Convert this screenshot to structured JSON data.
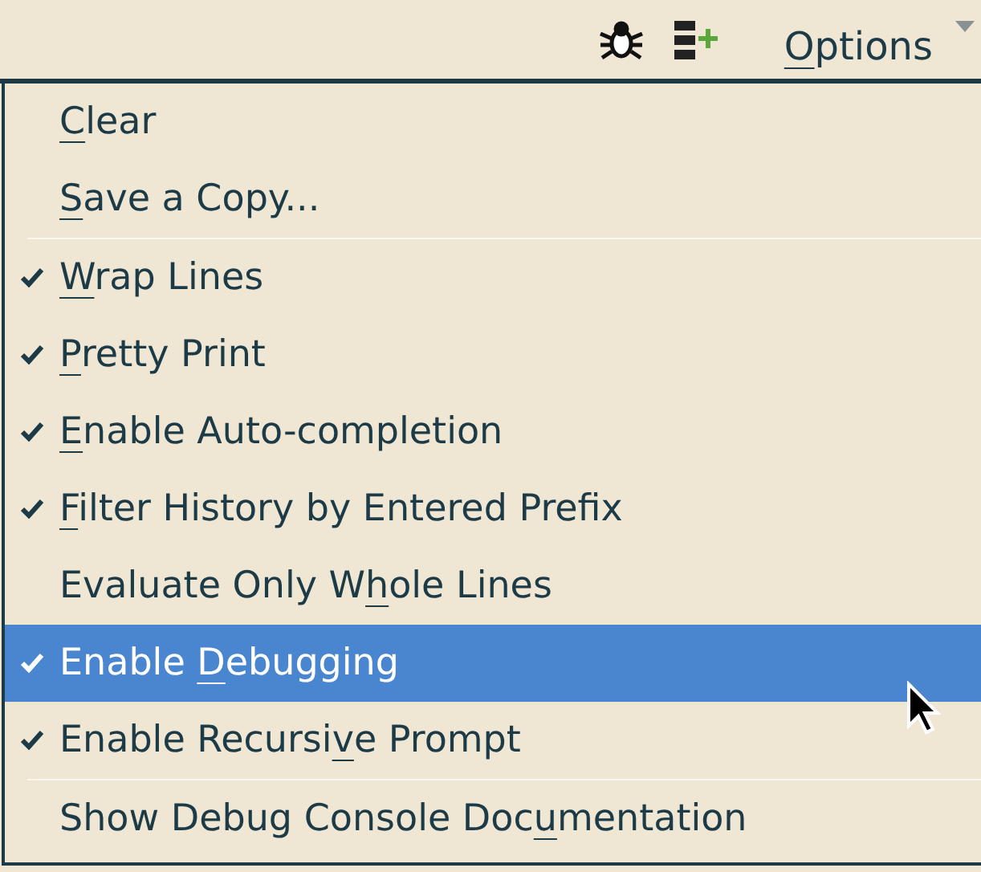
{
  "toolbar": {
    "options_menu": {
      "key": "O",
      "after": "ptions"
    }
  },
  "menu": {
    "items": [
      {
        "kind": "item",
        "checked": false,
        "selected": false,
        "key": "C",
        "after": "lear"
      },
      {
        "kind": "item",
        "checked": false,
        "selected": false,
        "key": "S",
        "after": "ave a Copy..."
      },
      {
        "kind": "separator"
      },
      {
        "kind": "item",
        "checked": true,
        "selected": false,
        "key": "W",
        "after": "rap Lines"
      },
      {
        "kind": "item",
        "checked": true,
        "selected": false,
        "key": "P",
        "after": "retty Print"
      },
      {
        "kind": "item",
        "checked": true,
        "selected": false,
        "key": "E",
        "after": "nable Auto-completion"
      },
      {
        "kind": "item",
        "checked": true,
        "selected": false,
        "key": "F",
        "after": "ilter History by Entered Prefix"
      },
      {
        "kind": "item",
        "checked": false,
        "selected": false,
        "before": "Evaluate Only W",
        "key": "h",
        "after": "ole Lines"
      },
      {
        "kind": "item",
        "checked": true,
        "selected": true,
        "before": "Enable ",
        "key": "D",
        "after": "ebugging"
      },
      {
        "kind": "item",
        "checked": true,
        "selected": false,
        "before": "Enable Recursi",
        "key": "v",
        "after": "e Prompt"
      },
      {
        "kind": "separator"
      },
      {
        "kind": "item",
        "checked": false,
        "selected": false,
        "before": "Show Debug Console Doc",
        "key": "u",
        "after": "mentation"
      }
    ]
  }
}
